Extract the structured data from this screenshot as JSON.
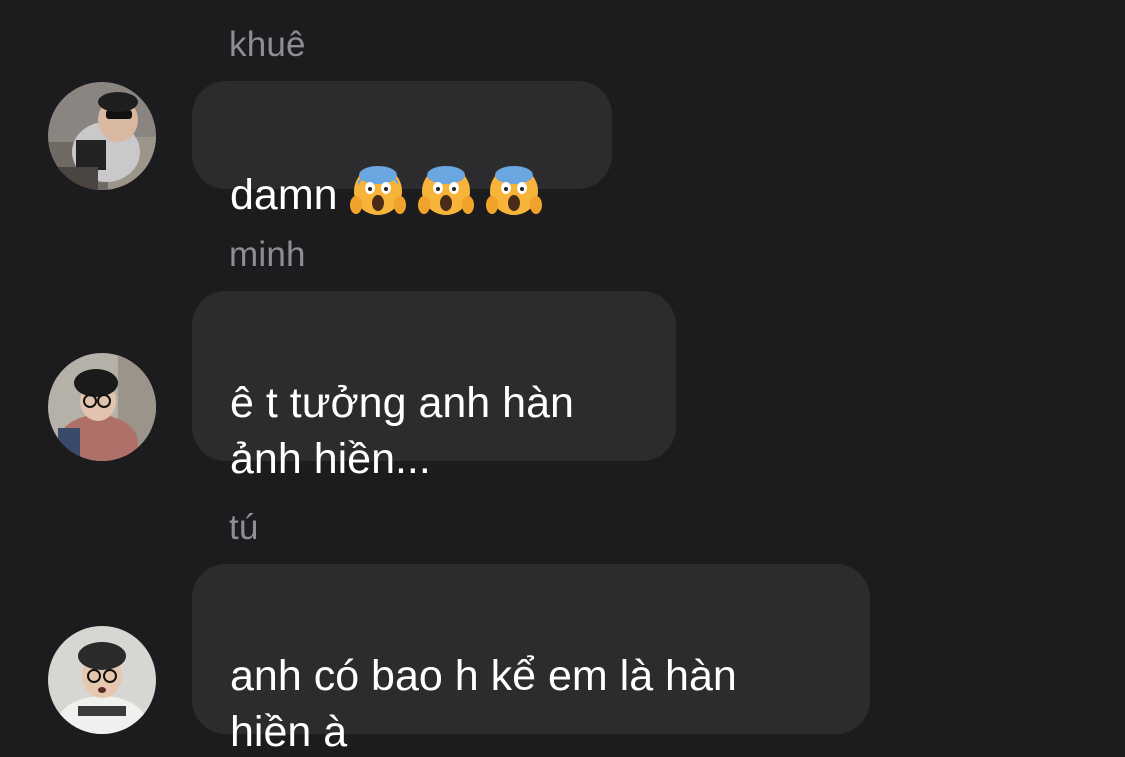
{
  "messages": [
    {
      "sender": "khuê",
      "text": "damn",
      "emojis": [
        "face-screaming-in-fear-icon",
        "face-screaming-in-fear-icon",
        "face-screaming-in-fear-icon"
      ]
    },
    {
      "sender": "minh",
      "text": "ê t tưởng anh hàn\nảnh hiền..."
    },
    {
      "sender": "tú",
      "text": "anh có bao h kể em là hàn\nhiền à"
    }
  ],
  "colors": {
    "background": "#1c1c1e",
    "bubble": "#2c2c2e",
    "sender_name": "#8e8e93",
    "message_text": "#ffffff"
  }
}
